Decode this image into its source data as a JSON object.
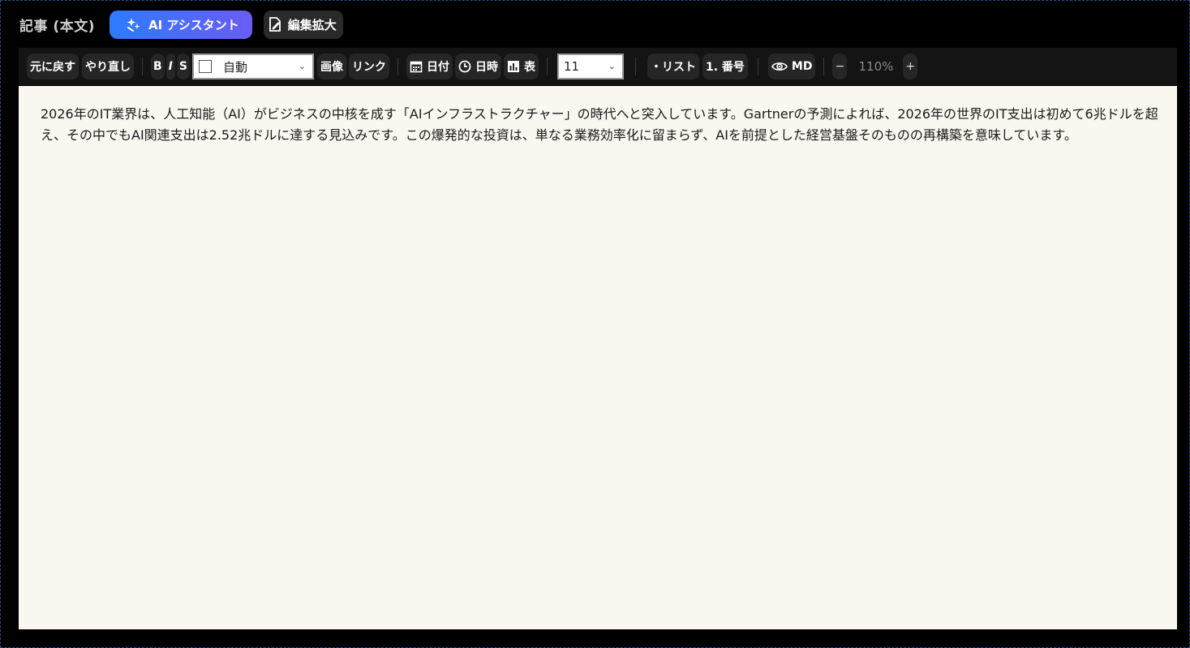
{
  "header": {
    "section_title": "記事 (本文)",
    "ai_button_label": "AI アシスタント",
    "expand_button_label": "編集拡大"
  },
  "toolbar": {
    "undo_label": "元に戻す",
    "redo_label": "やり直し",
    "bold_label": "B",
    "italic_label": "I",
    "strike_label": "S",
    "color_select_value": "自動",
    "image_label": "画像",
    "link_label": "リンク",
    "date_label": "日付",
    "datetime_label": "日時",
    "table_label": "表",
    "font_size_value": "11",
    "bullet_list_label": "・リスト",
    "numbered_list_label": "1. 番号",
    "md_label": "MD",
    "zoom_minus_label": "−",
    "zoom_value": "110%",
    "zoom_plus_label": "+"
  },
  "editor": {
    "body_text": "2026年のIT業界は、人工知能（AI）がビジネスの中核を成す「AIインフラストラクチャー」の時代へと突入しています。Gartnerの予測によれば、2026年の世界のIT支出は初めて6兆ドルを超え、その中でもAI関連支出は2.52兆ドルに達する見込みです。この爆発的な投資は、単なる業務効率化に留まらず、AIを前提とした経営基盤そのものの再構築を意味しています。"
  }
}
